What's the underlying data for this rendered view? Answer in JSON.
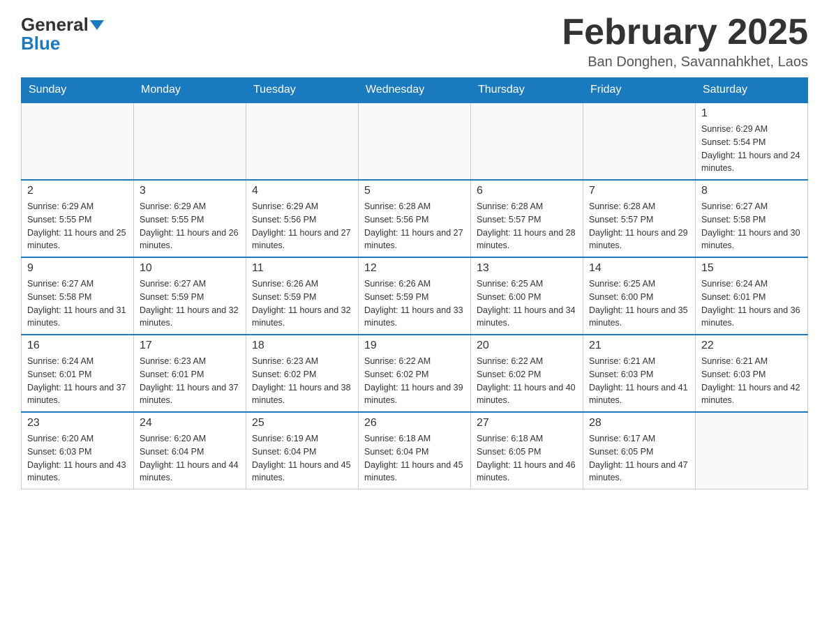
{
  "logo": {
    "general": "General",
    "blue": "Blue"
  },
  "header": {
    "month_title": "February 2025",
    "location": "Ban Donghen, Savannahkhet, Laos"
  },
  "days_of_week": [
    "Sunday",
    "Monday",
    "Tuesday",
    "Wednesday",
    "Thursday",
    "Friday",
    "Saturday"
  ],
  "weeks": [
    [
      {
        "day": "",
        "info": ""
      },
      {
        "day": "",
        "info": ""
      },
      {
        "day": "",
        "info": ""
      },
      {
        "day": "",
        "info": ""
      },
      {
        "day": "",
        "info": ""
      },
      {
        "day": "",
        "info": ""
      },
      {
        "day": "1",
        "info": "Sunrise: 6:29 AM\nSunset: 5:54 PM\nDaylight: 11 hours and 24 minutes."
      }
    ],
    [
      {
        "day": "2",
        "info": "Sunrise: 6:29 AM\nSunset: 5:55 PM\nDaylight: 11 hours and 25 minutes."
      },
      {
        "day": "3",
        "info": "Sunrise: 6:29 AM\nSunset: 5:55 PM\nDaylight: 11 hours and 26 minutes."
      },
      {
        "day": "4",
        "info": "Sunrise: 6:29 AM\nSunset: 5:56 PM\nDaylight: 11 hours and 27 minutes."
      },
      {
        "day": "5",
        "info": "Sunrise: 6:28 AM\nSunset: 5:56 PM\nDaylight: 11 hours and 27 minutes."
      },
      {
        "day": "6",
        "info": "Sunrise: 6:28 AM\nSunset: 5:57 PM\nDaylight: 11 hours and 28 minutes."
      },
      {
        "day": "7",
        "info": "Sunrise: 6:28 AM\nSunset: 5:57 PM\nDaylight: 11 hours and 29 minutes."
      },
      {
        "day": "8",
        "info": "Sunrise: 6:27 AM\nSunset: 5:58 PM\nDaylight: 11 hours and 30 minutes."
      }
    ],
    [
      {
        "day": "9",
        "info": "Sunrise: 6:27 AM\nSunset: 5:58 PM\nDaylight: 11 hours and 31 minutes."
      },
      {
        "day": "10",
        "info": "Sunrise: 6:27 AM\nSunset: 5:59 PM\nDaylight: 11 hours and 32 minutes."
      },
      {
        "day": "11",
        "info": "Sunrise: 6:26 AM\nSunset: 5:59 PM\nDaylight: 11 hours and 32 minutes."
      },
      {
        "day": "12",
        "info": "Sunrise: 6:26 AM\nSunset: 5:59 PM\nDaylight: 11 hours and 33 minutes."
      },
      {
        "day": "13",
        "info": "Sunrise: 6:25 AM\nSunset: 6:00 PM\nDaylight: 11 hours and 34 minutes."
      },
      {
        "day": "14",
        "info": "Sunrise: 6:25 AM\nSunset: 6:00 PM\nDaylight: 11 hours and 35 minutes."
      },
      {
        "day": "15",
        "info": "Sunrise: 6:24 AM\nSunset: 6:01 PM\nDaylight: 11 hours and 36 minutes."
      }
    ],
    [
      {
        "day": "16",
        "info": "Sunrise: 6:24 AM\nSunset: 6:01 PM\nDaylight: 11 hours and 37 minutes."
      },
      {
        "day": "17",
        "info": "Sunrise: 6:23 AM\nSunset: 6:01 PM\nDaylight: 11 hours and 37 minutes."
      },
      {
        "day": "18",
        "info": "Sunrise: 6:23 AM\nSunset: 6:02 PM\nDaylight: 11 hours and 38 minutes."
      },
      {
        "day": "19",
        "info": "Sunrise: 6:22 AM\nSunset: 6:02 PM\nDaylight: 11 hours and 39 minutes."
      },
      {
        "day": "20",
        "info": "Sunrise: 6:22 AM\nSunset: 6:02 PM\nDaylight: 11 hours and 40 minutes."
      },
      {
        "day": "21",
        "info": "Sunrise: 6:21 AM\nSunset: 6:03 PM\nDaylight: 11 hours and 41 minutes."
      },
      {
        "day": "22",
        "info": "Sunrise: 6:21 AM\nSunset: 6:03 PM\nDaylight: 11 hours and 42 minutes."
      }
    ],
    [
      {
        "day": "23",
        "info": "Sunrise: 6:20 AM\nSunset: 6:03 PM\nDaylight: 11 hours and 43 minutes."
      },
      {
        "day": "24",
        "info": "Sunrise: 6:20 AM\nSunset: 6:04 PM\nDaylight: 11 hours and 44 minutes."
      },
      {
        "day": "25",
        "info": "Sunrise: 6:19 AM\nSunset: 6:04 PM\nDaylight: 11 hours and 45 minutes."
      },
      {
        "day": "26",
        "info": "Sunrise: 6:18 AM\nSunset: 6:04 PM\nDaylight: 11 hours and 45 minutes."
      },
      {
        "day": "27",
        "info": "Sunrise: 6:18 AM\nSunset: 6:05 PM\nDaylight: 11 hours and 46 minutes."
      },
      {
        "day": "28",
        "info": "Sunrise: 6:17 AM\nSunset: 6:05 PM\nDaylight: 11 hours and 47 minutes."
      },
      {
        "day": "",
        "info": ""
      }
    ]
  ]
}
